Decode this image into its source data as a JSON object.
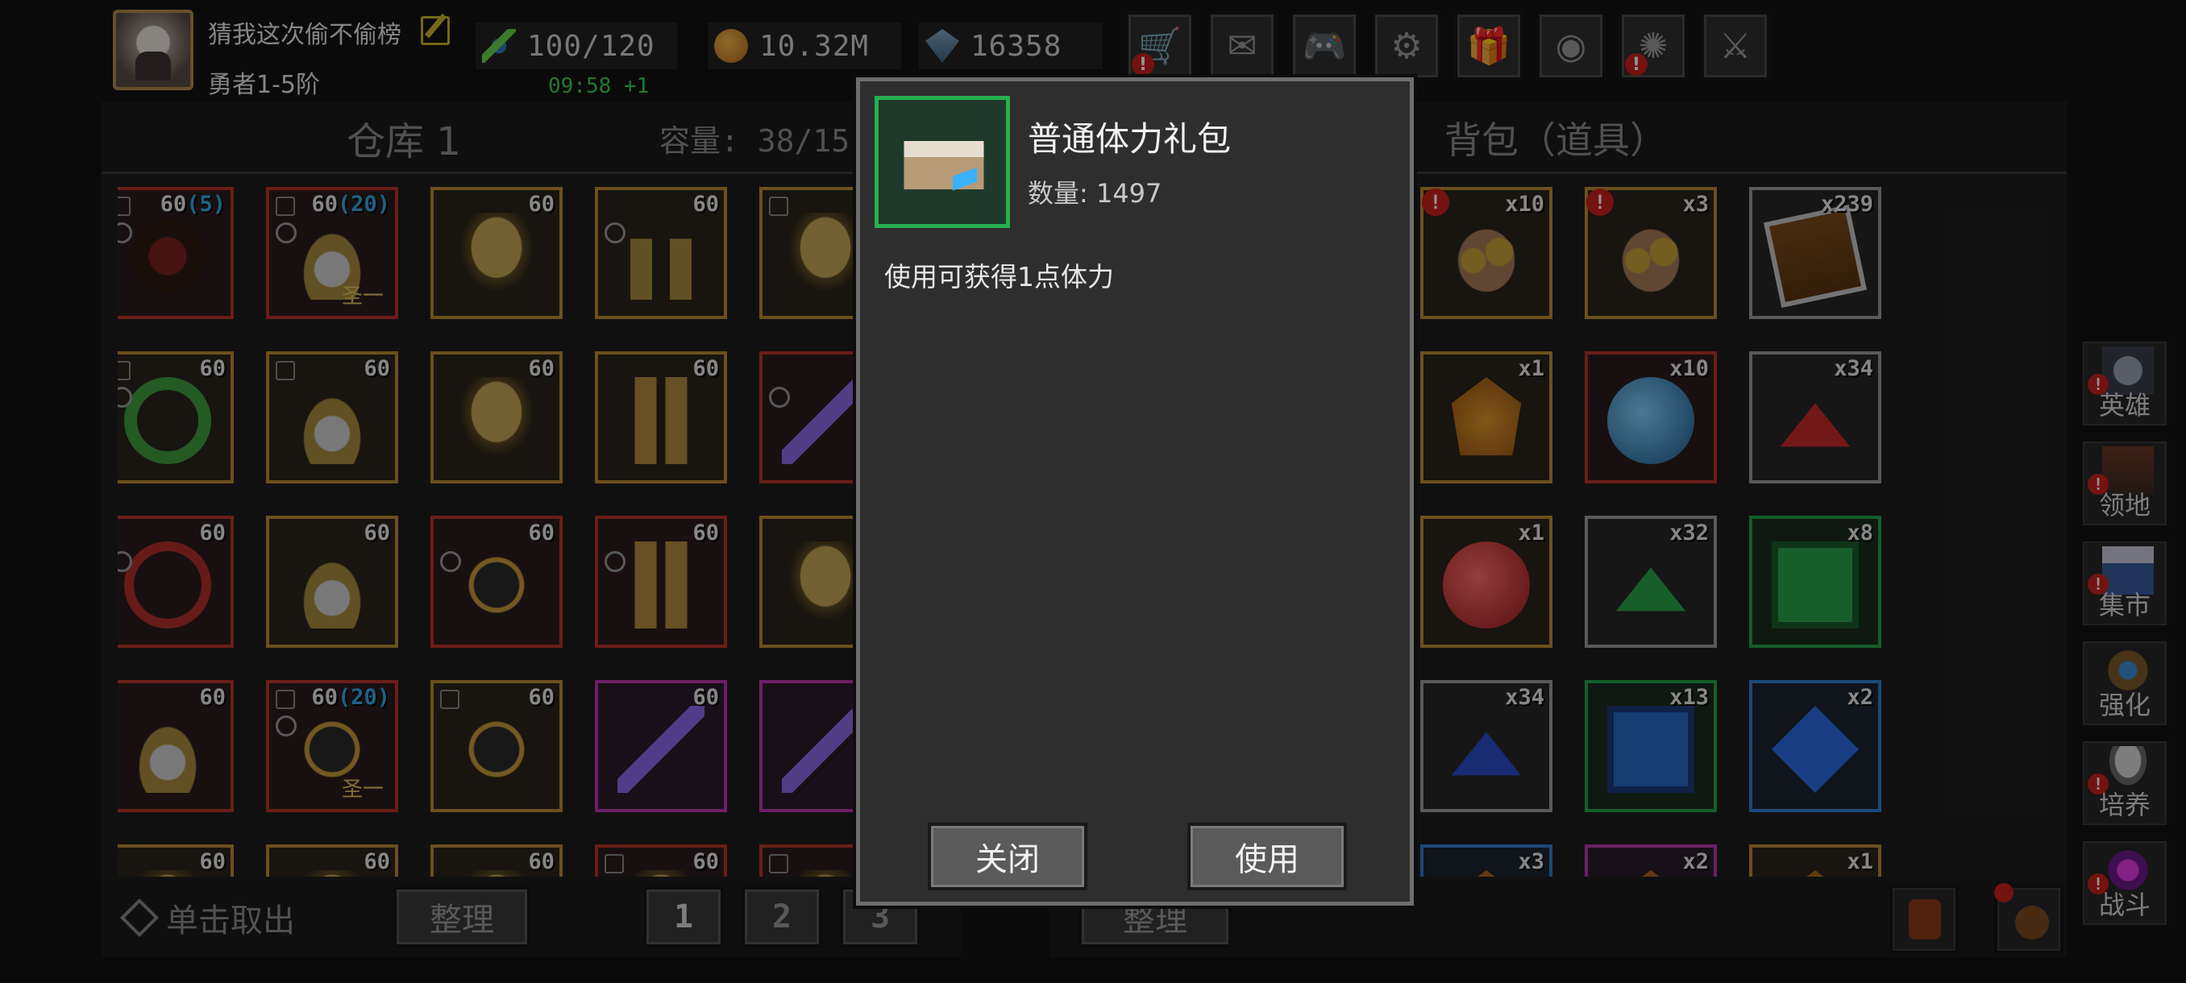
{
  "player": {
    "name": "猜我这次偷不偷榜",
    "rank": "勇者1-5阶"
  },
  "resources": {
    "energy": "100/120",
    "energy_timer": "09:58 +1",
    "gold": "10.32M",
    "gems": "16358"
  },
  "toolbar": [
    {
      "icon": "shop-cart-icon",
      "glyph": "🛒",
      "alert": true
    },
    {
      "icon": "mail-icon",
      "glyph": "✉",
      "alert": false
    },
    {
      "icon": "gamepad-icon",
      "glyph": "🎮",
      "alert": false
    },
    {
      "icon": "gear-icon",
      "glyph": "⚙",
      "alert": false
    },
    {
      "icon": "gift-icon",
      "glyph": "🎁",
      "alert": false
    },
    {
      "icon": "color-wheel-icon",
      "glyph": "◉",
      "alert": false
    },
    {
      "icon": "fireworks-icon",
      "glyph": "✺",
      "alert": true
    },
    {
      "icon": "swords-disabled-icon",
      "glyph": "⚔",
      "alert": false
    }
  ],
  "warehouse": {
    "title": "仓库 1",
    "capacity": "容量: 38/15",
    "take_out": "单击取出",
    "sort": "整理",
    "pages": [
      "1",
      "2",
      "3"
    ],
    "items": [
      {
        "art": "mask",
        "rarity": "r-red",
        "level": "60",
        "extra": "(5)",
        "lock": true,
        "circle": true,
        "tag": ""
      },
      {
        "art": "lock",
        "rarity": "r-red",
        "level": "60",
        "extra": "(20)",
        "lock": true,
        "circle": true,
        "tag": "圣一"
      },
      {
        "art": "helm",
        "rarity": "r-gold",
        "level": "60",
        "extra": "",
        "lock": false,
        "circle": false,
        "tag": ""
      },
      {
        "art": "boots",
        "rarity": "r-gold",
        "level": "60",
        "extra": "",
        "lock": false,
        "circle": true,
        "tag": ""
      },
      {
        "art": "helm",
        "rarity": "r-gold",
        "level": "",
        "extra": "",
        "lock": true,
        "circle": false,
        "tag": ""
      },
      {
        "art": "ring",
        "rarity": "r-gold",
        "level": "60",
        "extra": "",
        "lock": true,
        "circle": true,
        "tag": ""
      },
      {
        "art": "lock",
        "rarity": "r-gold",
        "level": "60",
        "extra": "",
        "lock": true,
        "circle": false,
        "tag": ""
      },
      {
        "art": "helm",
        "rarity": "r-gold",
        "level": "60",
        "extra": "",
        "lock": false,
        "circle": false,
        "tag": ""
      },
      {
        "art": "pants",
        "rarity": "r-gold",
        "level": "60",
        "extra": "",
        "lock": false,
        "circle": false,
        "tag": ""
      },
      {
        "art": "sword",
        "rarity": "r-red",
        "level": "",
        "extra": "",
        "lock": false,
        "circle": true,
        "tag": ""
      },
      {
        "art": "neck",
        "rarity": "r-red",
        "level": "60",
        "extra": "",
        "lock": false,
        "circle": true,
        "tag": ""
      },
      {
        "art": "lock",
        "rarity": "r-gold",
        "level": "60",
        "extra": "",
        "lock": false,
        "circle": false,
        "tag": ""
      },
      {
        "art": "glove",
        "rarity": "r-red",
        "level": "60",
        "extra": "",
        "lock": false,
        "circle": true,
        "tag": ""
      },
      {
        "art": "pants",
        "rarity": "r-red",
        "level": "60",
        "extra": "",
        "lock": false,
        "circle": true,
        "tag": ""
      },
      {
        "art": "helm",
        "rarity": "r-gold",
        "level": "",
        "extra": "",
        "lock": false,
        "circle": false,
        "tag": ""
      },
      {
        "art": "lock",
        "rarity": "r-red",
        "level": "60",
        "extra": "",
        "lock": false,
        "circle": false,
        "tag": ""
      },
      {
        "art": "glove",
        "rarity": "r-red",
        "level": "60",
        "extra": "(20)",
        "lock": true,
        "circle": true,
        "tag": "圣一"
      },
      {
        "art": "glove",
        "rarity": "r-gold",
        "level": "60",
        "extra": "",
        "lock": true,
        "circle": false,
        "tag": ""
      },
      {
        "art": "sword",
        "rarity": "r-purple",
        "level": "60",
        "extra": "",
        "lock": false,
        "circle": false,
        "tag": ""
      },
      {
        "art": "sword",
        "rarity": "r-purple",
        "level": "",
        "extra": "",
        "lock": false,
        "circle": false,
        "tag": ""
      },
      {
        "art": "helm",
        "rarity": "r-gold",
        "level": "60",
        "extra": "",
        "lock": false,
        "circle": false,
        "tag": ""
      },
      {
        "art": "helm",
        "rarity": "r-gold",
        "level": "60",
        "extra": "",
        "lock": false,
        "circle": false,
        "tag": ""
      },
      {
        "art": "helm",
        "rarity": "r-gold",
        "level": "60",
        "extra": "",
        "lock": false,
        "circle": false,
        "tag": ""
      },
      {
        "art": "helm",
        "rarity": "r-red",
        "level": "60",
        "extra": "",
        "lock": true,
        "circle": false,
        "tag": ""
      },
      {
        "art": "helm",
        "rarity": "r-red",
        "level": "",
        "extra": "",
        "lock": true,
        "circle": false,
        "tag": ""
      }
    ]
  },
  "bag": {
    "title": "背包（道具）",
    "sort": "整理",
    "items": [
      {
        "art": "chest",
        "rarity": "r-green",
        "count": "x1497",
        "warn": true
      },
      {
        "art": "ore",
        "rarity": "r-gold",
        "count": "x10",
        "warn": true
      },
      {
        "art": "ore",
        "rarity": "r-gold",
        "count": "x3",
        "warn": true
      },
      {
        "art": "book",
        "rarity": "r-gray",
        "count": "x239",
        "warn": false
      },
      {
        "art": "rune",
        "rarity": "r-purple",
        "count": "x3",
        "warn": false
      },
      {
        "art": "amber",
        "rarity": "r-gold",
        "count": "x1",
        "warn": false
      },
      {
        "art": "orb",
        "rarity": "r-red",
        "count": "x10",
        "warn": false
      },
      {
        "art": "pile-red",
        "rarity": "r-gray",
        "count": "x34",
        "warn": false
      },
      {
        "art": "ball-red",
        "rarity": "r-purple",
        "count": "x2",
        "warn": false
      },
      {
        "art": "ball-red",
        "rarity": "r-gold",
        "count": "x1",
        "warn": false
      },
      {
        "art": "pile-green",
        "rarity": "r-gray",
        "count": "x32",
        "warn": false
      },
      {
        "art": "sq-green",
        "rarity": "r-green",
        "count": "x8",
        "warn": false
      },
      {
        "art": "ball-green",
        "rarity": "r-gold",
        "count": "x1",
        "warn": false
      },
      {
        "art": "pile-blue",
        "rarity": "r-gray",
        "count": "x34",
        "warn": false
      },
      {
        "art": "sq-blue",
        "rarity": "r-green",
        "count": "x13",
        "warn": false
      },
      {
        "art": "dia-blue",
        "rarity": "r-blue",
        "count": "x2",
        "warn": false
      },
      {
        "art": "rune",
        "rarity": "r-green",
        "count": "x11",
        "warn": false
      },
      {
        "art": "amber",
        "rarity": "r-blue",
        "count": "x3",
        "warn": false
      },
      {
        "art": "amber",
        "rarity": "r-purple",
        "count": "x2",
        "warn": false
      },
      {
        "art": "amber",
        "rarity": "r-gold",
        "count": "x1",
        "warn": false
      }
    ]
  },
  "side_menu": [
    {
      "label": "英雄",
      "icon": "hero-helmet-icon",
      "alert": true
    },
    {
      "label": "领地",
      "icon": "castle-icon",
      "alert": true
    },
    {
      "label": "集市",
      "icon": "market-stall-icon",
      "alert": true
    },
    {
      "label": "强化",
      "icon": "enhance-crest-icon",
      "alert": false
    },
    {
      "label": "培养",
      "icon": "grail-icon",
      "alert": true
    },
    {
      "label": "战斗",
      "icon": "portal-icon",
      "alert": true
    }
  ],
  "dialog": {
    "title": "普通体力礼包",
    "count": "数量: 1497",
    "description": "使用可获得1点体力",
    "close_label": "关闭",
    "use_label": "使用"
  }
}
